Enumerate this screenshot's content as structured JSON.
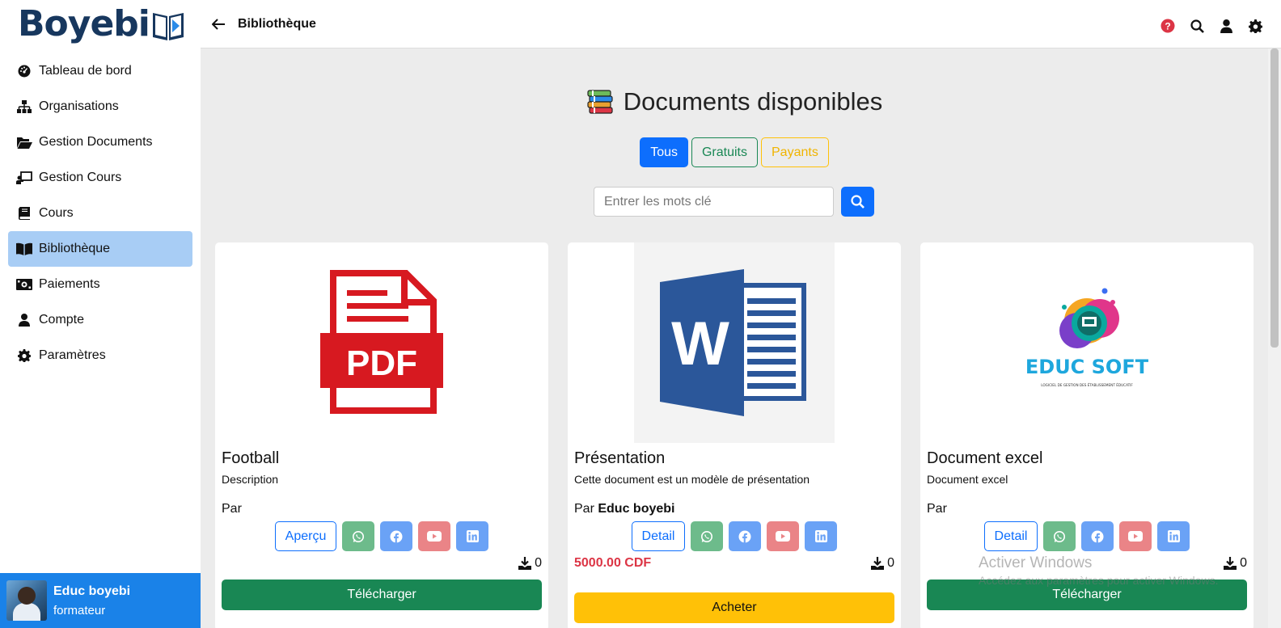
{
  "app": {
    "logo_text": "Boyebi"
  },
  "sidebar": {
    "items": [
      {
        "label": "Tableau de bord",
        "icon": "dashboard-icon"
      },
      {
        "label": "Organisations",
        "icon": "sitemap-icon"
      },
      {
        "label": "Gestion Documents",
        "icon": "folder-open-icon"
      },
      {
        "label": "Gestion Cours",
        "icon": "chalkboard-teacher-icon"
      },
      {
        "label": "Cours",
        "icon": "book-icon"
      },
      {
        "label": "Bibliothèque",
        "icon": "book-open-icon",
        "active": true
      },
      {
        "label": "Paiements",
        "icon": "money-bill-icon"
      },
      {
        "label": "Compte",
        "icon": "user-icon"
      },
      {
        "label": "Paramètres",
        "icon": "gear-icon"
      }
    ],
    "user": {
      "name": "Educ boyebi",
      "role": "formateur"
    }
  },
  "topbar": {
    "title": "Bibliothèque"
  },
  "main": {
    "heading": "Documents disponibles",
    "filters": {
      "all": "Tous",
      "free": "Gratuits",
      "paid": "Payants"
    },
    "search": {
      "placeholder": "Entrer les mots clé"
    }
  },
  "cards": [
    {
      "title": "Football",
      "description": "Description",
      "by_label": "Par",
      "author": "",
      "detail_label": "Aperçu",
      "downloads": "0",
      "price": "",
      "action_label": "Télécharger",
      "image": "pdf-icon"
    },
    {
      "title": "Présentation",
      "description": "Cette document est un modèle de présentation",
      "by_label": "Par",
      "author": "Educ boyebi",
      "detail_label": "Detail",
      "downloads": "0",
      "price": "5000.00 CDF",
      "action_label": "Acheter",
      "image": "word-icon"
    },
    {
      "title": "Document excel",
      "description": "Document excel",
      "by_label": "Par",
      "author": "",
      "detail_label": "Detail",
      "downloads": "0",
      "price": "",
      "action_label": "Télécharger",
      "image": "educ-soft-logo"
    }
  ],
  "educ_soft": {
    "name": "EDUC SOFT",
    "tagline": "LOGICIEL DE GESTION DES ÉTABLISSEMENT ÉDUCATIF"
  },
  "watermark": {
    "title": "Activer Windows",
    "subtitle": "Accédez aux paramètres pour activer Windows."
  },
  "colors": {
    "primary": "#0d6efd",
    "success": "#198754",
    "warning": "#ffc107",
    "danger": "#dc3545",
    "sidebar_active": "#a8cdf5",
    "user_box": "#1a82e8"
  }
}
